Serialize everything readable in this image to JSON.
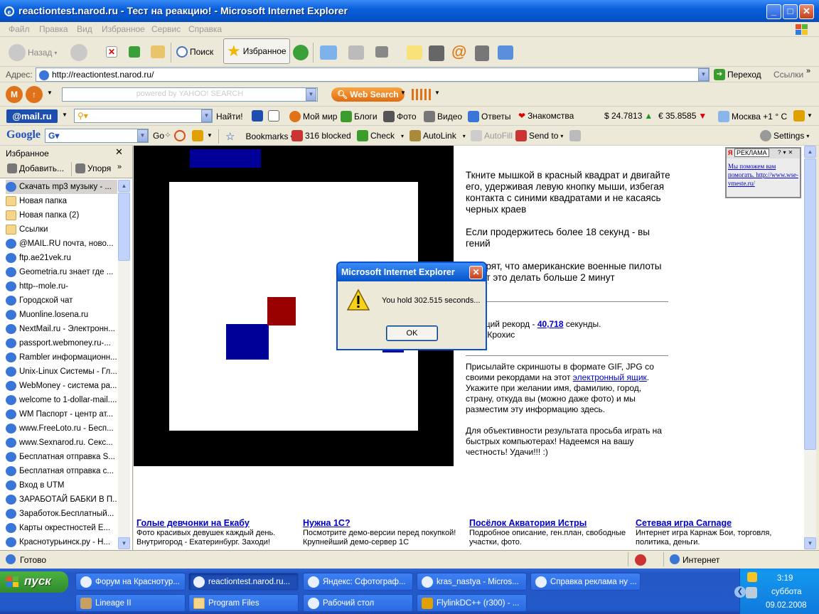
{
  "window": {
    "title": "reactiontest.narod.ru - Тест на реакцию! - Microsoft Internet Explorer",
    "min": "_",
    "max": "□",
    "close": "✕"
  },
  "menu": [
    "Файл",
    "Правка",
    "Вид",
    "Избранное",
    "Сервис",
    "Справка"
  ],
  "toolbar": {
    "back": "Назад",
    "search": "Поиск",
    "favorites": "Избранное"
  },
  "address": {
    "label": "Адрес:",
    "url": "http://reactiontest.narod.ru/",
    "go": "Переход",
    "links": "Ссылки"
  },
  "yahoo": {
    "placeholder": "powered by YAHOO! SEARCH",
    "search_btn": "Web Search"
  },
  "mailru": {
    "logo": "@mail.ru",
    "find": "Найти!",
    "my_world": "Мой мир",
    "blogs": "Блоги",
    "photo": "Фото",
    "video": "Видео",
    "answers": "Ответы",
    "dating": "Знакомства",
    "usd": "$ 24.7813",
    "eur": "€ 35.8585",
    "weather": "Москва +1 ° C"
  },
  "google": {
    "logo": "Google",
    "go": "Go",
    "bookmarks": "Bookmarks",
    "blocked": "316 blocked",
    "check": "Check",
    "autolink": "AutoLink",
    "autofill": "AutoFill",
    "send": "Send to",
    "settings": "Settings"
  },
  "favorites": {
    "title": "Избранное",
    "add": "Добавить...",
    "organize": "Упоря",
    "items": [
      {
        "label": "Скачать mp3 музыку - ...",
        "type": "link",
        "selected": true
      },
      {
        "label": "Новая папка",
        "type": "folder"
      },
      {
        "label": "Новая папка (2)",
        "type": "folder"
      },
      {
        "label": "Ссылки",
        "type": "folder"
      },
      {
        "label": "@MAIL.RU почта, ново...",
        "type": "link"
      },
      {
        "label": "ftp.ae21vek.ru",
        "type": "link"
      },
      {
        "label": "Geometria.ru знает где ...",
        "type": "link"
      },
      {
        "label": "http--mole.ru-",
        "type": "link"
      },
      {
        "label": "Городской чат",
        "type": "link"
      },
      {
        "label": "Muonline.losena.ru",
        "type": "link"
      },
      {
        "label": "NextMail.ru - Электронн...",
        "type": "link"
      },
      {
        "label": "passport.webmoney.ru-...",
        "type": "link"
      },
      {
        "label": "Rambler информационн...",
        "type": "link"
      },
      {
        "label": "Unix-Linux Системы - Гл...",
        "type": "link"
      },
      {
        "label": "WebMoney - система ра...",
        "type": "link"
      },
      {
        "label": "welcome to 1-dollar-mail....",
        "type": "link"
      },
      {
        "label": "WM Паспорт - центр ат...",
        "type": "link"
      },
      {
        "label": "www.FreeLoto.ru - Бесп...",
        "type": "link"
      },
      {
        "label": "www.Sexnarod.ru. Секс...",
        "type": "link"
      },
      {
        "label": "Бесплатная отправка S...",
        "type": "link"
      },
      {
        "label": "Бесплатная отправка с...",
        "type": "link"
      },
      {
        "label": "Вход в UTM",
        "type": "link"
      },
      {
        "label": "ЗАРАБОТАЙ БАБКИ В П...",
        "type": "link"
      },
      {
        "label": "Заработок.Бесплатный...",
        "type": "link"
      },
      {
        "label": "Карты окрестностей Е...",
        "type": "link"
      },
      {
        "label": "Краснотурьинск.ру - Н...",
        "type": "link"
      }
    ]
  },
  "page": {
    "instructions": [
      "Ткните мышкой в красный квадрат и двигайте его, удерживая левую кнопку мыши, избегая контакта с синими квадратами и не касаясь черных краев",
      "Если продержитесь более 18 секунд - вы гений",
      "Говорят, что американские военные пилоты могут это делать больше 2 минут"
    ],
    "record_prefix": "Текущий рекорд - ",
    "record_value": "40,718",
    "record_suffix": " секунды.",
    "record_holder": "Кира Крохис",
    "submit_1a": "Присылайте скриншоты в формате GIF, JPG со своими рекордами на этот ",
    "submit_link": "электронный ящик",
    "submit_1b": ". Укажите при желании имя, фамилию, город, страну, откуда вы (можно даже фото) и мы разместим эту информацию здесь.",
    "submit_2": "Для объективности результата просьба играть на быстрых компьютерах! Надеемся на вашу честность! Удачи!!! :)",
    "ad": {
      "label": "РЕКЛАМА",
      "text": "Мы поможем вам помогать. http://www.wse-vmeste.ru/"
    },
    "bottom_ads": [
      {
        "title": "Голые девчонки на Екабу",
        "text": "Фото красивых девушек каждый день. Внутригород - Екатеринбург. Заходи!"
      },
      {
        "title": "Нужна 1С?",
        "text": "Посмотрите демо-версии перед покупкой! Крупнейший демо-сервер 1С"
      },
      {
        "title": "Посёлок Акватория Истры",
        "text": "Подробное описание, ген.план, свободные участки, фото."
      },
      {
        "title": "Сетевая игра Carnage",
        "text": "Интернет игра Карнаж Бои, торговля, политика, деньги."
      }
    ]
  },
  "dialog": {
    "title": "Microsoft Internet Explorer",
    "message": "You hold 302.515 seconds...",
    "ok": "OK"
  },
  "status": {
    "text": "Готово",
    "zone": "Интернет"
  },
  "taskbar": {
    "start": "пуск",
    "tasks_row1": [
      "Форум на Краснотур...",
      "reactiontest.narod.ru...",
      "Яндекс: Сфотограф...",
      "kras_nastya - Micros...",
      "Справка реклама ну ..."
    ],
    "tasks_row2": [
      "Lineage II",
      "Program Files",
      "Рабочий стол",
      "FlylinkDC++ (r300) - ..."
    ],
    "time": "3:19",
    "day": "суббота",
    "date": "09.02.2008"
  },
  "colors": {
    "player": "#990000",
    "enemy": "#000099",
    "border": "#000000",
    "field": "#ffffff"
  }
}
